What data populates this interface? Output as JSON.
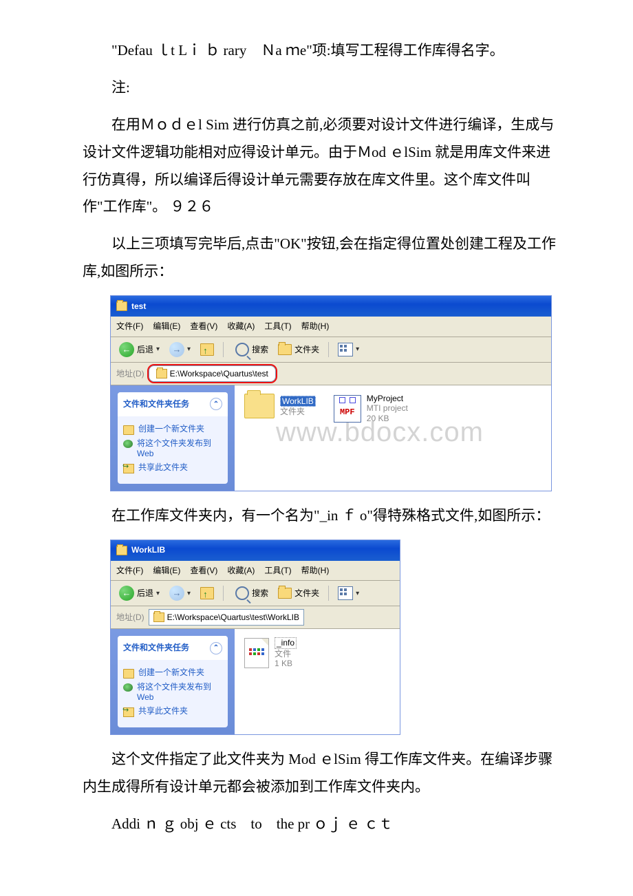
{
  "p1": "\"Defau ｌt Lｉ ｂ rary　Ｎa ｍe\"项:填写工程得工作库得名字。",
  "p2": "注:",
  "p3": "在用Ｍｏｄｅl Sim 进行仿真之前,必须要对设计文件进行编译，生成与设计文件逻辑功能相对应得设计单元。由于Ｍod ｅlSim 就是用库文件来进行仿真得，所以编译后得设计单元需要存放在库文件里。这个库文件叫作\"工作库\"。 ９２６",
  "p4": "以上三项填写完毕后,点击\"OK\"按钮,会在指定得位置处创建工程及工作库,如图所示：",
  "p5": "在工作库文件夹内，有一个名为\"_in ｆ o\"得特殊格式文件,如图所示：",
  "p6": "这个文件指定了此文件夹为 Mod ｅlSim 得工作库文件夹。在编译步骤内生成得所有设计单元都会被添加到工作库文件夹内。",
  "p7": "Addi ｎ ｇ obj ｅ cts　to　the pr ｏｊ ｅ ｃｔ",
  "watermark": "www.bdocx.com",
  "explorer": {
    "menu": {
      "file": "文件(F)",
      "edit": "编辑(E)",
      "view": "查看(V)",
      "fav": "收藏(A)",
      "tools": "工具(T)",
      "help": "帮助(H)"
    },
    "toolbar": {
      "back": "后退",
      "search": "搜索",
      "folders": "文件夹"
    },
    "address_label": "地址(D)",
    "tasks": {
      "header": "文件和文件夹任务",
      "t1": "创建一个新文件夹",
      "t2": "将这个文件夹发布到 Web",
      "t3": "共享此文件夹"
    }
  },
  "win1": {
    "title": "test",
    "address": "E:\\Workspace\\Quartus\\test",
    "files": {
      "folder": {
        "name": "WorkLIB",
        "type": "文件夹"
      },
      "project": {
        "name": "MyProject",
        "line2": "MTI project",
        "line3": "20 KB"
      }
    }
  },
  "win2": {
    "title": "WorkLIB",
    "address": "E:\\Workspace\\Quartus\\test\\WorkLIB",
    "file": {
      "name": "_info",
      "type": "文件",
      "size": "1 KB"
    }
  }
}
